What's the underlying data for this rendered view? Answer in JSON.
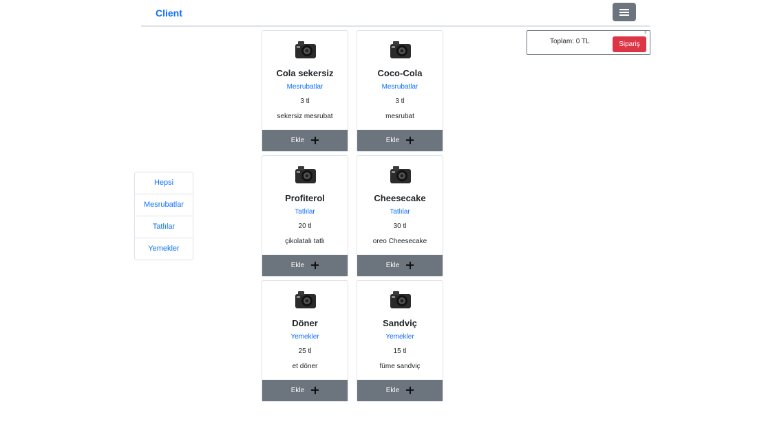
{
  "navbar": {
    "brand": "Client",
    "menu_icon": "hamburger-icon"
  },
  "categories": [
    "Hepsi",
    "Mesrubatlar",
    "Tatlılar",
    "Yemekler"
  ],
  "cart": {
    "total_label": "Toplam: 0 TL",
    "order_label": "Sipariş",
    "order_color": "#dc3545"
  },
  "products": [
    {
      "name": "Cola sekersiz",
      "category": "Mesrubatlar",
      "price": "3 tl",
      "description": "sekersiz mesrubat",
      "add_label": "Ekle",
      "icon": "camera-icon"
    },
    {
      "name": "Coco-Cola",
      "category": "Mesrubatlar",
      "price": "3 tl",
      "description": "mesrubat",
      "add_label": "Ekle",
      "icon": "camera-icon"
    },
    {
      "name": "Profiterol",
      "category": "Tatlılar",
      "price": "20 tl",
      "description": "çikolatalı tatlı",
      "add_label": "Ekle",
      "icon": "camera-icon"
    },
    {
      "name": "Cheesecake",
      "category": "Tatlılar",
      "price": "30 tl",
      "description": "oreo Cheesecake",
      "add_label": "Ekle",
      "icon": "camera-icon"
    },
    {
      "name": "Döner",
      "category": "Yemekler",
      "price": "25 tl",
      "description": "et döner",
      "add_label": "Ekle",
      "icon": "camera-icon"
    },
    {
      "name": "Sandviç",
      "category": "Yemekler",
      "price": "15 tl",
      "description": "füme sandviç",
      "add_label": "Ekle",
      "icon": "camera-icon"
    }
  ],
  "colors": {
    "link": "#0d6efd",
    "button": "#6c757d",
    "danger": "#dc3545"
  }
}
